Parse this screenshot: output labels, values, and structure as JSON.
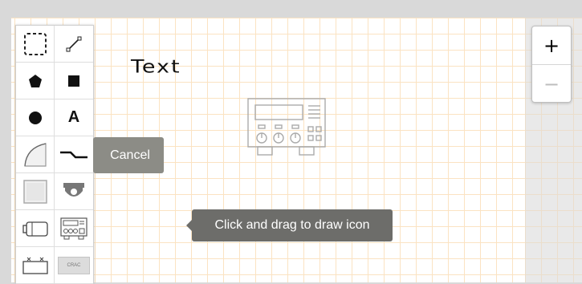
{
  "canvas": {
    "text_label": "Text"
  },
  "toolbar": {
    "tools": [
      {
        "name": "select-tool"
      },
      {
        "name": "line-tool"
      },
      {
        "name": "polygon-tool"
      },
      {
        "name": "rectangle-tool"
      },
      {
        "name": "circle-tool"
      },
      {
        "name": "text-tool",
        "glyph": "A"
      },
      {
        "name": "arc-tool"
      },
      {
        "name": "connector-tool"
      },
      {
        "name": "panel-tool"
      },
      {
        "name": "camera-tool"
      },
      {
        "name": "battery-tool"
      },
      {
        "name": "device-panel-tool"
      },
      {
        "name": "ups-tool"
      },
      {
        "name": "crac-tool",
        "label": "CRAC"
      }
    ]
  },
  "tooltips": {
    "cancel": "Cancel",
    "drag_hint": "Click and drag to draw icon"
  },
  "zoom": {
    "in_label": "+",
    "out_label": "−"
  },
  "colors": {
    "grid_line": "#fbe3c2",
    "tooltip_cancel": "#8c8c86",
    "tooltip_hint": "#6d6d6a",
    "device_stroke": "#aaaaaa"
  }
}
